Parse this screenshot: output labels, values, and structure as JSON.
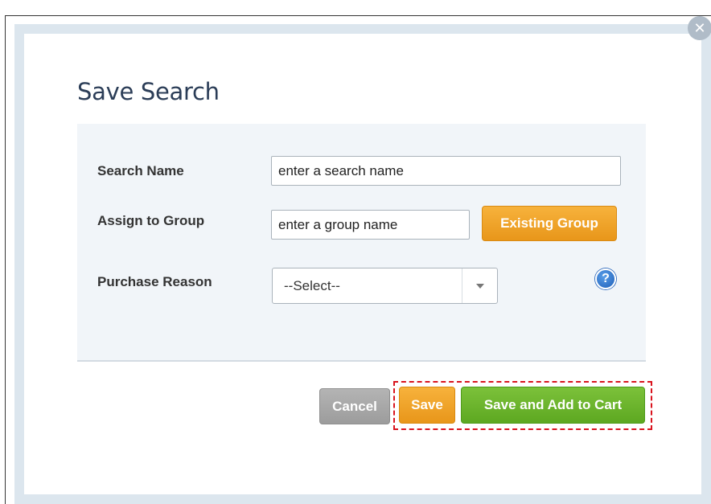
{
  "dialog": {
    "title": "Save Search",
    "close_icon": "close-icon"
  },
  "form": {
    "search_name": {
      "label": "Search Name",
      "value": "enter a search name"
    },
    "assign_group": {
      "label": "Assign to Group",
      "value": "enter a group name",
      "existing_button": "Existing Group"
    },
    "purchase_reason": {
      "label": "Purchase Reason",
      "selected": "--Select--",
      "help_icon": "help-icon",
      "help_glyph": "?"
    }
  },
  "actions": {
    "cancel": "Cancel",
    "save": "Save",
    "save_add_cart": "Save and Add to Cart"
  },
  "colors": {
    "title": "#2b3d57",
    "orange_button": "#e8961a",
    "green_button": "#5da821",
    "grey_button": "#9c9c9c",
    "highlight": "#d9141e",
    "panel": "#f1f5f9"
  }
}
